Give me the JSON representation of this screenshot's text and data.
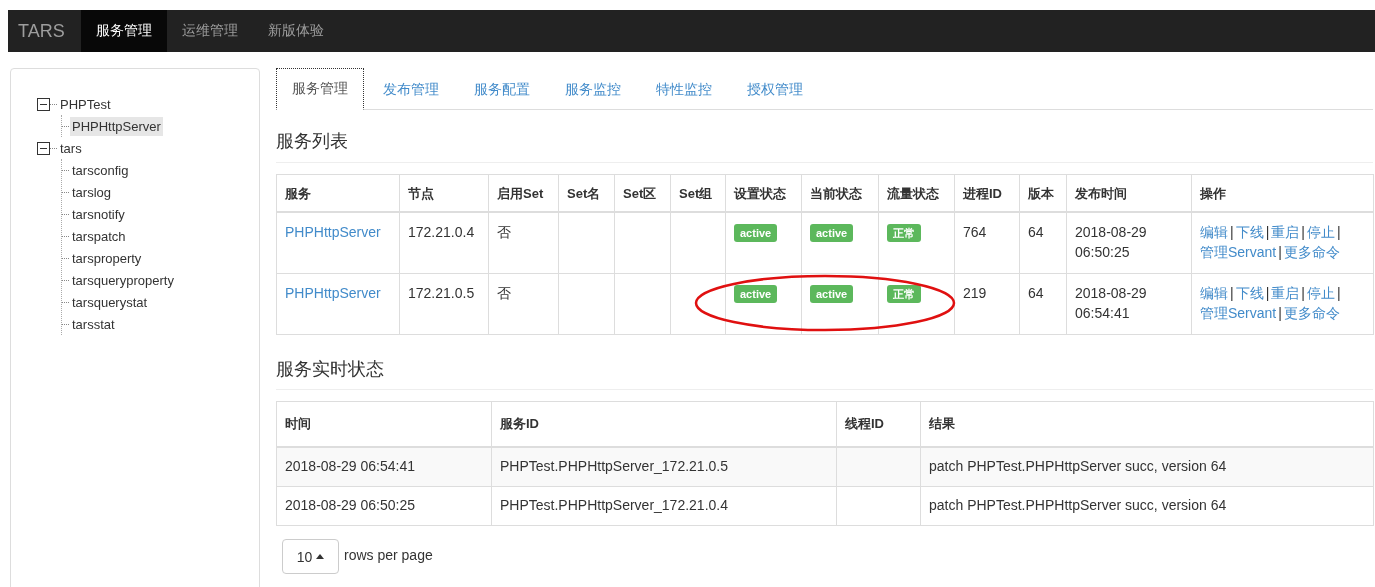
{
  "navbar": {
    "brand": "TARS",
    "items": [
      {
        "label": "服务管理",
        "selected": true
      },
      {
        "label": "运维管理",
        "selected": false
      },
      {
        "label": "新版体验",
        "selected": false
      }
    ]
  },
  "tree": [
    {
      "label": "PHPTest",
      "expanded": true,
      "selected": false,
      "children": [
        {
          "label": "PHPHttpServer",
          "selected": true
        }
      ]
    },
    {
      "label": "tars",
      "expanded": true,
      "selected": false,
      "children": [
        {
          "label": "tarsconfig",
          "selected": false
        },
        {
          "label": "tarslog",
          "selected": false
        },
        {
          "label": "tarsnotify",
          "selected": false
        },
        {
          "label": "tarspatch",
          "selected": false
        },
        {
          "label": "tarsproperty",
          "selected": false
        },
        {
          "label": "tarsqueryproperty",
          "selected": false
        },
        {
          "label": "tarsquerystat",
          "selected": false
        },
        {
          "label": "tarsstat",
          "selected": false
        }
      ]
    }
  ],
  "tabs": [
    {
      "label": "服务管理",
      "selected": true
    },
    {
      "label": "发布管理",
      "selected": false
    },
    {
      "label": "服务配置",
      "selected": false
    },
    {
      "label": "服务监控",
      "selected": false
    },
    {
      "label": "特性监控",
      "selected": false
    },
    {
      "label": "授权管理",
      "selected": false
    }
  ],
  "service_list": {
    "title": "服务列表",
    "columns": [
      "服务",
      "节点",
      "启用Set",
      "Set名",
      "Set区",
      "Set组",
      "设置状态",
      "当前状态",
      "流量状态",
      "进程ID",
      "版本",
      "发布时间",
      "操作"
    ],
    "rows": [
      {
        "service": "PHPHttpServer",
        "node": "172.21.0.4",
        "set_enabled": "否",
        "setting_state": "active",
        "current_state": "active",
        "traffic_state": "正常",
        "pid": "764",
        "version": "64",
        "publish_date": "2018-08-29",
        "publish_time": "06:50:25",
        "highlighted": false,
        "actions": [
          {
            "label": "编辑",
            "sep": "|"
          },
          {
            "label": "下线",
            "sep": "|"
          },
          {
            "label": "重启",
            "sep": "|"
          },
          {
            "label": "停止",
            "sep": "|"
          },
          {
            "label": "管理Servant",
            "sep": "|"
          },
          {
            "label": "更多命令"
          }
        ]
      },
      {
        "service": "PHPHttpServer",
        "node": "172.21.0.5",
        "set_enabled": "否",
        "setting_state": "active",
        "current_state": "active",
        "traffic_state": "正常",
        "pid": "219",
        "version": "64",
        "publish_date": "2018-08-29",
        "publish_time": "06:54:41",
        "highlighted": true,
        "actions": [
          {
            "label": "编辑",
            "sep": "|"
          },
          {
            "label": "下线",
            "sep": "|"
          },
          {
            "label": "重启",
            "sep": "|"
          },
          {
            "label": "停止",
            "sep": "|"
          },
          {
            "label": "管理Servant",
            "sep": "|"
          },
          {
            "label": "更多命令"
          }
        ]
      }
    ]
  },
  "realtime_status": {
    "title": "服务实时状态",
    "columns": [
      "时间",
      "服务ID",
      "线程ID",
      "结果"
    ],
    "rows": [
      [
        "2018-08-29 06:54:41",
        "PHPTest.PHPHttpServer_172.21.0.5",
        "",
        "patch PHPTest.PHPHttpServer succ, version 64"
      ],
      [
        "2018-08-29 06:50:25",
        "PHPTest.PHPHttpServer_172.21.0.4",
        "",
        "patch PHPTest.PHPHttpServer succ, version 64"
      ]
    ]
  },
  "pagination": {
    "page_size": "10",
    "label": "rows per page"
  }
}
